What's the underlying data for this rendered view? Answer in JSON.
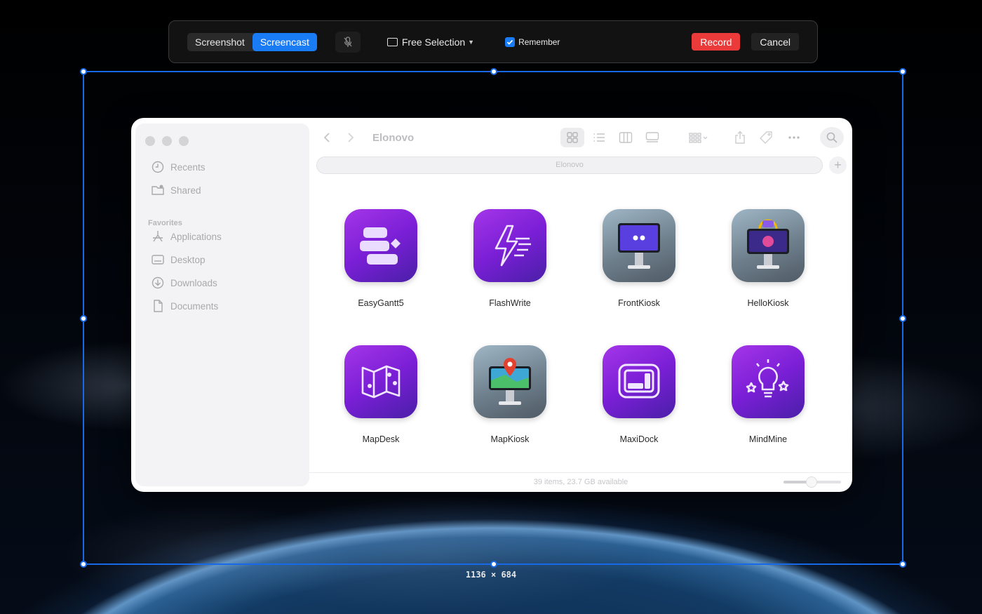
{
  "capture_bar": {
    "screenshot_label": "Screenshot",
    "screencast_label": "Screencast",
    "mic_icon": "mic-off-icon",
    "selection_label": "Free Selection",
    "remember_label": "Remember",
    "remember_checked": true,
    "record_label": "Record",
    "cancel_label": "Cancel"
  },
  "selection": {
    "dimensions_label": "1136 × 684"
  },
  "finder": {
    "folder_title": "Elonovo",
    "path_label": "Elonovo",
    "sidebar": {
      "items": [
        {
          "label": "Recents",
          "icon": "clock-icon"
        },
        {
          "label": "Shared",
          "icon": "shared-folder-icon"
        }
      ],
      "favorites_heading": "Favorites",
      "favorites": [
        {
          "label": "Applications",
          "icon": "applications-icon"
        },
        {
          "label": "Desktop",
          "icon": "desktop-icon"
        },
        {
          "label": "Downloads",
          "icon": "download-icon"
        },
        {
          "label": "Documents",
          "icon": "document-icon"
        }
      ]
    },
    "apps": [
      {
        "name": "EasyGantt5",
        "style": "purple"
      },
      {
        "name": "FlashWrite",
        "style": "purple"
      },
      {
        "name": "FrontKiosk",
        "style": "grey"
      },
      {
        "name": "HelloKiosk",
        "style": "grey"
      },
      {
        "name": "MapDesk",
        "style": "purple"
      },
      {
        "name": "MapKiosk",
        "style": "grey"
      },
      {
        "name": "MaxiDock",
        "style": "purple"
      },
      {
        "name": "MindMine",
        "style": "purple"
      }
    ],
    "status_text": "39 items, 23.7 GB available"
  },
  "colors": {
    "accent_blue": "#1a7cf5",
    "record_red": "#ea3a3a",
    "app_purple": "#8a2be2"
  }
}
